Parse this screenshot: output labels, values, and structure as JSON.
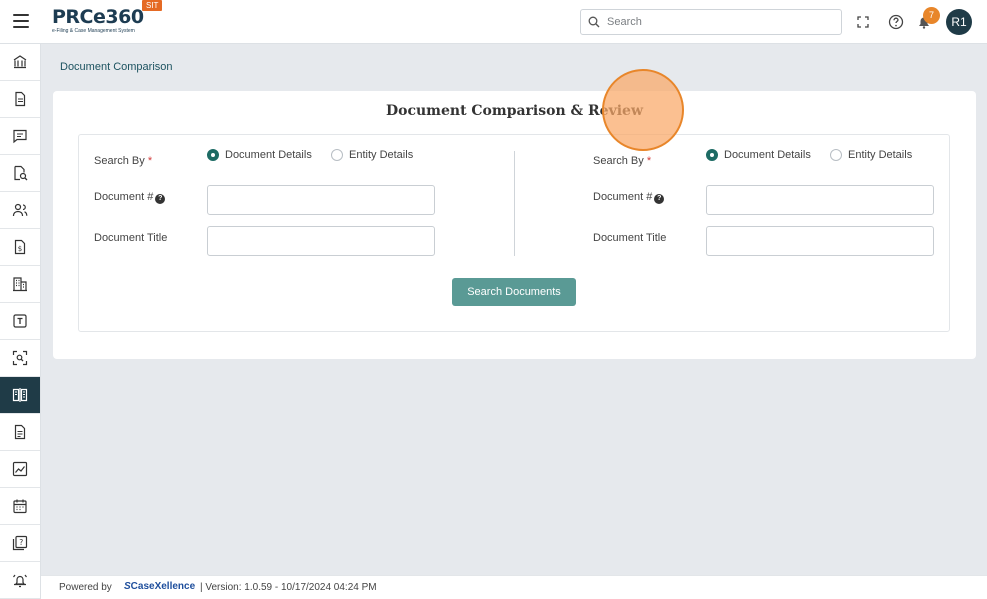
{
  "header": {
    "logo_text": "PRCe360",
    "logo_subtitle": "e-Filing & Case Management System",
    "env_badge": "SIT",
    "search_placeholder": "Search",
    "notification_count": "7",
    "avatar_initials": "R1"
  },
  "sidebar": {
    "items": [
      {
        "icon": "bank-icon"
      },
      {
        "icon": "document-icon"
      },
      {
        "icon": "chat-icon"
      },
      {
        "icon": "document-search-icon"
      },
      {
        "icon": "users-icon"
      },
      {
        "icon": "document-dollar-icon"
      },
      {
        "icon": "building-icon"
      },
      {
        "icon": "template-icon"
      },
      {
        "icon": "scan-icon"
      },
      {
        "icon": "compare-icon",
        "active": true
      },
      {
        "icon": "report-icon"
      },
      {
        "icon": "chart-icon"
      },
      {
        "icon": "calendar-icon"
      },
      {
        "icon": "help-document-icon"
      },
      {
        "icon": "alarm-icon"
      }
    ]
  },
  "breadcrumb": "Document Comparison",
  "card": {
    "title": "Document Comparison & Review",
    "left": {
      "search_by_label": "Search By",
      "required_mark": "*",
      "option_document": "Document Details",
      "option_entity": "Entity Details",
      "selected": "Document Details",
      "doc_number_label": "Document #",
      "doc_title_label": "Document Title",
      "doc_number_value": "",
      "doc_title_value": ""
    },
    "right": {
      "search_by_label": "Search By",
      "required_mark": "*",
      "option_document": "Document Details",
      "option_entity": "Entity Details",
      "selected": "Document Details",
      "doc_number_label": "Document #",
      "doc_title_label": "Document Title",
      "doc_number_value": "",
      "doc_title_value": ""
    },
    "search_button": "Search Documents"
  },
  "footer": {
    "powered_by": "Powered by",
    "brand": "CaseXellence",
    "version": "|  Version: 1.0.59 - 10/17/2024 04:24 PM"
  },
  "colors": {
    "primary_dark": "#1f3b47",
    "accent_teal": "#5a9a95",
    "radio_checked": "#1d6b64",
    "badge_orange": "#e8862a",
    "required_red": "#d23a3a"
  }
}
